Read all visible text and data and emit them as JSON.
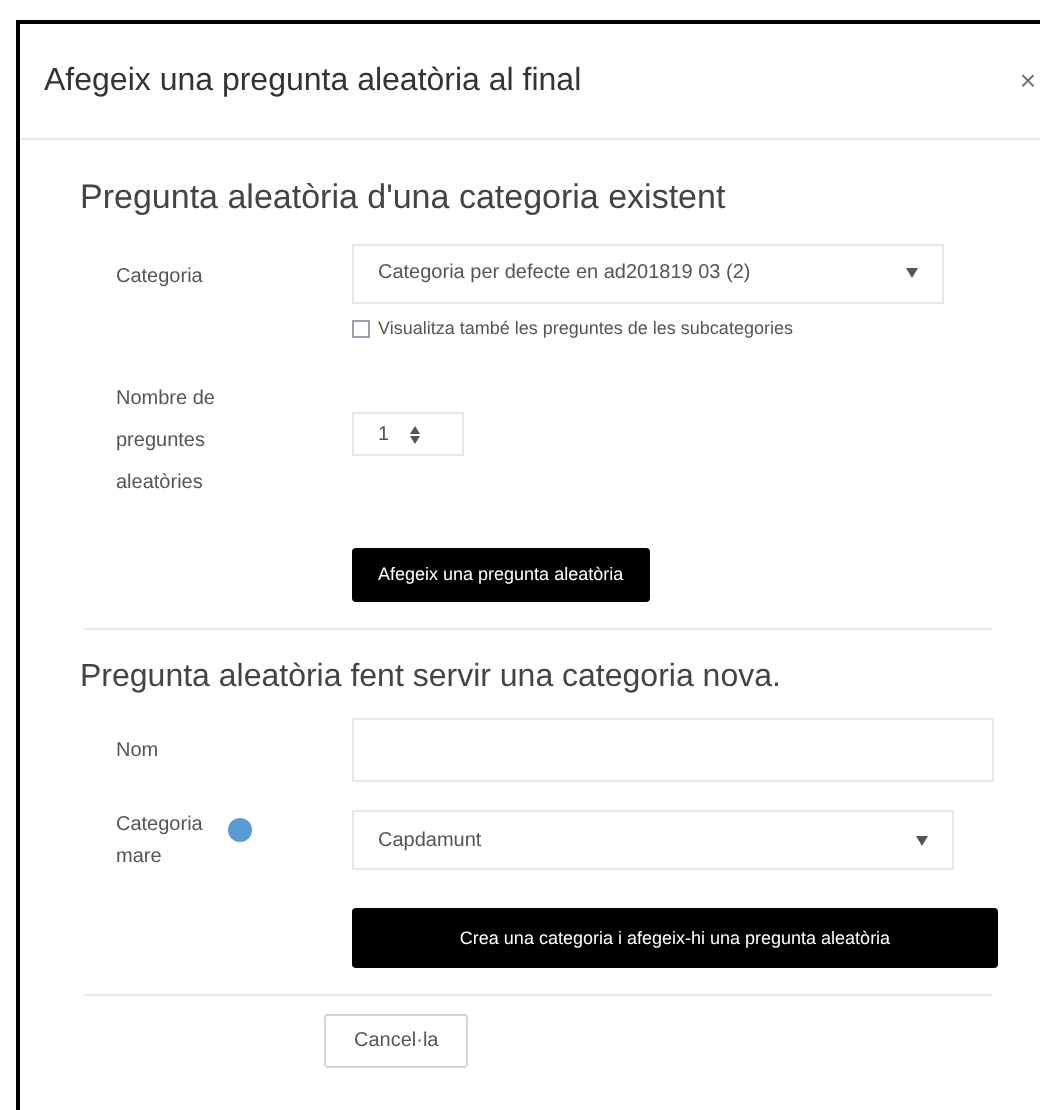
{
  "dialog": {
    "title": "Afegeix una pregunta aleatòria al final",
    "close": "×"
  },
  "existing": {
    "heading": "Pregunta aleatòria d'una categoria existent",
    "category_label": "Categoria",
    "category_value": "Categoria per defecte en ad201819 03 (2)",
    "subcategories": {
      "label": "Visualitza també les preguntes de les subcategories",
      "checked": false
    },
    "count_label": "Nombre de preguntes aleatòries",
    "count_value": "1",
    "button": "Afegeix una pregunta aleatòria"
  },
  "new": {
    "heading": "Pregunta aleatòria fent servir una categoria nova.",
    "name_label": "Nom",
    "parent_label": "Categoria mare",
    "parent_value": "Capdamunt",
    "button": "Crea una categoria i afegeix-hi una pregunta aleatòria"
  },
  "cancel": "Cancel·la"
}
